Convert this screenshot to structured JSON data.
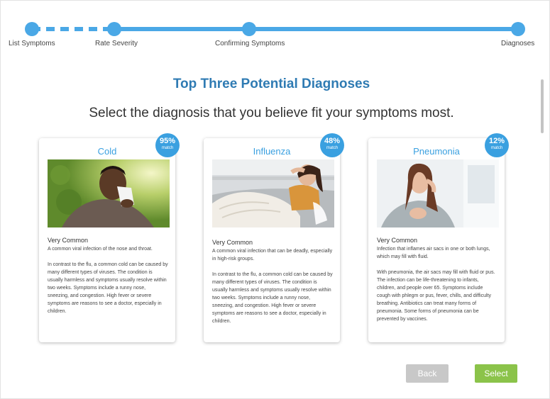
{
  "progress": {
    "steps": [
      {
        "label": "List Symptoms"
      },
      {
        "label": "Rate Severity"
      },
      {
        "label": "Confirming Symptoms"
      },
      {
        "label": "Diagnoses"
      }
    ]
  },
  "page": {
    "title": "Top Three Potential Diagnoses",
    "subtitle": "Select the diagnosis that you believe fit your symptoms most."
  },
  "cards": [
    {
      "title": "Cold",
      "match_pct": "95%",
      "match_label": "match",
      "frequency": "Very Common",
      "paragraphs": [
        "A common viral infection of the nose and throat.",
        "In contrast to the flu, a common cold can be caused by many different types of viruses. The condition is usually harmless and symptoms usually resolve within two weeks. Symptoms include a runny nose, sneezing, and congestion. High fever or severe symptoms are reasons to see a doctor, especially in children."
      ]
    },
    {
      "title": "Influenza",
      "match_pct": "48%",
      "match_label": "match",
      "frequency": "Very Common",
      "paragraphs": [
        "A common viral infection that can be deadly, especially in high-risk groups.",
        "In contrast to the flu, a common cold can be caused by many different types of viruses. The condition is usually harmless and symptoms usually resolve within two weeks. Symptoms include a runny nose, sneezing, and congestion. High fever or severe symptoms are reasons to see a doctor, especially in children."
      ]
    },
    {
      "title": "Pneumonia",
      "match_pct": "12%",
      "match_label": "match",
      "frequency": "Very Common",
      "paragraphs": [
        "Infection that inflames air sacs in one or both lungs, which may fill with fluid.",
        "With pneumonia, the air sacs may fill with fluid or pus. The infection can be life-threatening to infants, children, and people over 65. Symptoms include cough with phlegm or pus, fever, chills, and difficulty breathing. Antibiotics can treat many forms of pneumonia. Some forms of pneumonia can be prevented by vaccines."
      ]
    }
  ],
  "buttons": {
    "back": "Back",
    "select": "Select"
  },
  "colors": {
    "accent": "#3aa0e0",
    "title": "#2f7bb3",
    "select": "#8bc34a",
    "back": "#c8c8c8"
  }
}
